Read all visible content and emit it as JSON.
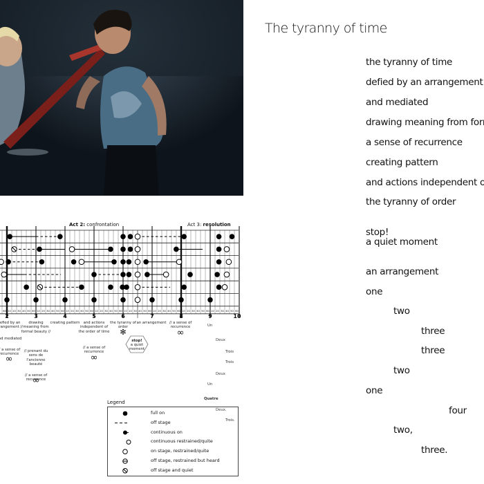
{
  "poem": {
    "title": "The tyranny of time",
    "lines": [
      {
        "text": "the tyranny of time",
        "indent": 0
      },
      {
        "text": "defied by an arrangement",
        "indent": 0
      },
      {
        "text": "and mediated",
        "indent": 0
      },
      {
        "text": "drawing meaning from forma",
        "indent": 0
      },
      {
        "text": "a sense of recurrence",
        "indent": 0
      },
      {
        "text": "creating pattern",
        "indent": 0
      },
      {
        "text": "and actions independent of t",
        "indent": 0
      },
      {
        "text": "the tyranny of order",
        "indent": 0
      },
      {
        "text": "stop!",
        "indent": 0
      },
      {
        "text": "a quiet moment",
        "indent": 0
      },
      {
        "text": "an arrangement",
        "indent": 0
      },
      {
        "text": "one",
        "indent": 0
      },
      {
        "text": "two",
        "indent": 1
      },
      {
        "text": "three",
        "indent": 2
      },
      {
        "text": "three",
        "indent": 2
      },
      {
        "text": "two",
        "indent": 1
      },
      {
        "text": "one",
        "indent": 0
      },
      {
        "text": "four",
        "indent": 3
      },
      {
        "text": "two,",
        "indent": 1
      },
      {
        "text": "three.",
        "indent": 2
      }
    ]
  },
  "score": {
    "act2": {
      "prefix": "Act 2:",
      "name": "confrontation"
    },
    "act3": {
      "prefix": "Act 3:",
      "name": "resolution"
    },
    "minutes": [
      2,
      3,
      4,
      5,
      6,
      7,
      8,
      9,
      10
    ],
    "ticks": [
      "10",
      "20",
      "30",
      "40",
      "50",
      "60"
    ],
    "rows": [
      {
        "marks": [
          [
            2.1,
            "full"
          ],
          [
            3.83,
            "full"
          ],
          [
            6,
            "full"
          ],
          [
            6.25,
            "full"
          ],
          [
            6.5,
            "open"
          ],
          [
            8.1,
            "full"
          ],
          [
            9.3,
            "full"
          ],
          [
            9.75,
            "full"
          ]
        ],
        "segs": [
          [
            2.1,
            3,
            "solid"
          ],
          [
            3,
            3.83,
            "dashed"
          ],
          [
            6.5,
            8.1,
            "dashed"
          ]
        ]
      },
      {
        "marks": [
          [
            2.25,
            "crossed"
          ],
          [
            3.12,
            "full"
          ],
          [
            4.24,
            "open"
          ],
          [
            5.57,
            "full"
          ],
          [
            6,
            "full"
          ],
          [
            6.25,
            "full"
          ],
          [
            6.5,
            "open"
          ],
          [
            7.83,
            "full"
          ],
          [
            9.3,
            "full"
          ],
          [
            9.57,
            "open"
          ]
        ],
        "segs": [
          [
            2.25,
            3.12,
            "dashed"
          ],
          [
            3.12,
            4,
            "solid"
          ],
          [
            4.24,
            5.57,
            "solid"
          ],
          [
            7.83,
            8.74,
            "solid"
          ]
        ]
      },
      {
        "marks": [
          [
            1.8,
            "open"
          ],
          [
            2.05,
            "full"
          ],
          [
            3.2,
            "full"
          ],
          [
            4.3,
            "full"
          ],
          [
            4.57,
            "open"
          ],
          [
            5.69,
            "full"
          ],
          [
            6,
            "full"
          ],
          [
            6.2,
            "full"
          ],
          [
            6.5,
            "open"
          ],
          [
            6.79,
            "full"
          ],
          [
            7.93,
            "open"
          ],
          [
            9.3,
            "full"
          ],
          [
            9.64,
            "open"
          ]
        ],
        "segs": [
          [
            2.05,
            3.2,
            "dashed"
          ],
          [
            4.57,
            5.69,
            "solid"
          ],
          [
            6.79,
            7.93,
            "solid"
          ]
        ]
      },
      {
        "marks": [
          [
            1.9,
            "open"
          ],
          [
            5,
            "full"
          ],
          [
            6,
            "full"
          ],
          [
            6.2,
            "full"
          ],
          [
            6.5,
            "open"
          ],
          [
            6.83,
            "full"
          ],
          [
            7.48,
            "open"
          ],
          [
            8.31,
            "full"
          ],
          [
            9.24,
            "full"
          ],
          [
            9.57,
            "open"
          ]
        ],
        "segs": [
          [
            1.9,
            2.6,
            "solid"
          ],
          [
            2.6,
            3.86,
            "dashed"
          ],
          [
            5,
            6,
            "dashed"
          ],
          [
            6.83,
            7.48,
            "solid"
          ]
        ]
      },
      {
        "marks": [
          [
            2.67,
            "full"
          ],
          [
            3.14,
            "crossed"
          ],
          [
            4.57,
            "full"
          ],
          [
            5.57,
            "full"
          ],
          [
            5.98,
            "full"
          ],
          [
            6.12,
            "full"
          ],
          [
            6.5,
            "open"
          ],
          [
            8.1,
            "full"
          ],
          [
            9.3,
            "full"
          ],
          [
            9.5,
            "open"
          ]
        ],
        "segs": [
          [
            3.14,
            4.57,
            "dashed"
          ],
          [
            6.5,
            7.62,
            "dashed"
          ]
        ]
      },
      {
        "marks": [
          [
            2,
            "full"
          ],
          [
            3,
            "full"
          ],
          [
            4,
            "full"
          ],
          [
            5,
            "full"
          ],
          [
            6,
            "full"
          ],
          [
            6.5,
            "open"
          ],
          [
            7,
            "full"
          ],
          [
            8,
            "full"
          ],
          [
            9,
            "full"
          ]
        ],
        "segs": []
      }
    ],
    "labels": {
      "m2": [
        "defied by an arrangement //",
        "and mediated",
        "// a sense of recurrence"
      ],
      "m3": [
        "drawing meaning from formal beauty //",
        "// prenant du sens de l'ancienne beauté",
        "// a sense of recurrence"
      ],
      "m4": [
        "creating pattern"
      ],
      "m5": [
        "and actions independent of the order of time",
        "// a sense of recurrence"
      ],
      "m6": [
        "the tyranny of order"
      ],
      "m7": [
        "an arrangement"
      ],
      "m8": [
        "// a sense of recurrence"
      ],
      "stop": [
        "stop!",
        "a quiet moment"
      ],
      "infinity": "∞",
      "asterisk": "✻",
      "french": [
        {
          "text": "Un",
          "level": 0
        },
        {
          "text": "Deux",
          "level": 1
        },
        {
          "text": "Trois",
          "level": 2
        },
        {
          "text": "Trois",
          "level": 2
        },
        {
          "text": "Deux",
          "level": 1
        },
        {
          "text": "Un",
          "level": 0
        },
        {
          "text": "Quatre",
          "level": 0,
          "bold": true
        },
        {
          "text": "Deux.",
          "level": 1
        },
        {
          "text": "Trois.",
          "level": 2
        }
      ]
    },
    "legend": {
      "title": "Legend",
      "items": [
        {
          "symbol": "full",
          "label": "full on"
        },
        {
          "symbol": "dashed",
          "label": "off stage"
        },
        {
          "symbol": "full-line",
          "label": "continuous on"
        },
        {
          "symbol": "open-line",
          "label": "continuous restrained/quite"
        },
        {
          "symbol": "open",
          "label": "on stage, restrained/quite"
        },
        {
          "symbol": "half",
          "label": "off stage, restrained but heard"
        },
        {
          "symbol": "crossed",
          "label": "off stage and quiet"
        }
      ]
    }
  }
}
